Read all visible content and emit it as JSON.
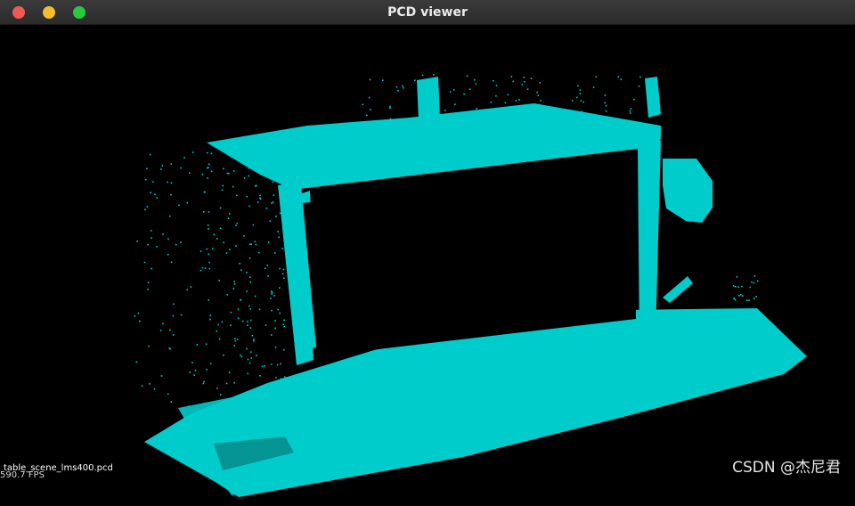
{
  "window": {
    "title": "PCD viewer"
  },
  "viewer": {
    "filename": "table_scene_lms400.pcd",
    "fps_text": "590.7 FPS",
    "point_color": "#00cccc",
    "background_color": "#000000"
  },
  "watermark": "CSDN @杰尼君"
}
